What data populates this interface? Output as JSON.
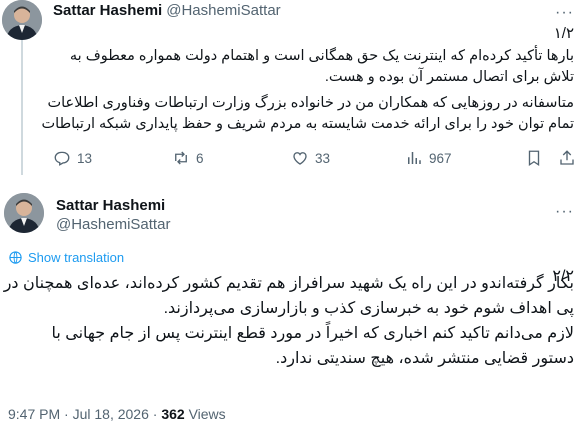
{
  "tweet1": {
    "name": "Sattar Hashemi",
    "handle": "@HashemiSattar",
    "index": "۱/۲",
    "lines": [
      "بارها تأکید کرده‌ام که اینترنت یک حق همگانی است و اهتمام دولت همواره معطوف به",
      "تلاش برای اتصال مستمر آن بوده و هست.",
      "متاسفانه در روزهایی که همکاران من در خانواده بزرگ وزارت ارتباطات وفناوری اطلاعات",
      "تمام توان خود را برای ارائه خدمت شایسته به مردم شریف و حفظ پایداری شبکه ارتباطات"
    ],
    "stats": {
      "replies": "13",
      "reposts": "6",
      "likes": "33",
      "views": "967"
    }
  },
  "tweet2": {
    "name": "Sattar Hashemi",
    "handle": "@HashemiSattar",
    "translate": "Show translation",
    "index": "۲/۲",
    "lines": [
      "بکار گرفته‌اندو در این راه یک شهید سرافراز هم تقدیم کشور کرده‌اند، عده‌ای همچنان در",
      "پی اهداف شوم خود به خبرسازی کذب و بازارسازی می‌پردازند.",
      "لازم می‌دانم تاکید کنم اخباری که اخیراً در مورد قطع اینترنت پس از جام جهانی با",
      "دستور قضایی منتشر شده، هیچ سندیتی ندارد."
    ],
    "timestamp": "9:47 PM · Jul 18, 2026 · ",
    "views": "362",
    "views_label": "Views"
  },
  "icons": [
    "more-icon",
    "reply-icon",
    "repost-icon",
    "like-icon",
    "views-icon",
    "bookmark-icon",
    "share-icon",
    "globe-icon"
  ]
}
